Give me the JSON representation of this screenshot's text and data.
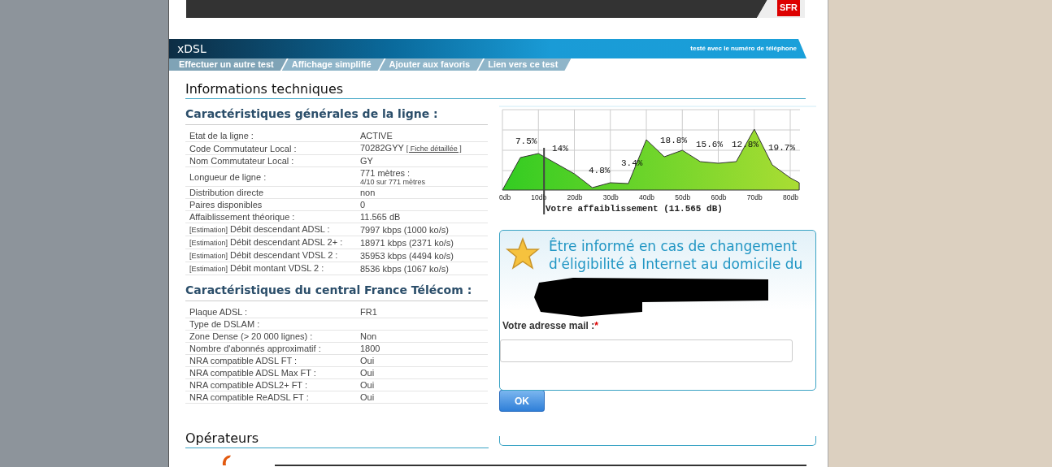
{
  "banner": {
    "logo": "SFR"
  },
  "section_bar": {
    "title": "xDSL",
    "note": "testé avec le numéro de téléphone"
  },
  "tabs": [
    {
      "label": "Effectuer un autre test"
    },
    {
      "label": "Affichage simplifié"
    },
    {
      "label": "Ajouter aux favoris"
    },
    {
      "label": "Lien vers ce test"
    }
  ],
  "page_heading": "Informations techniques",
  "line_section": {
    "title": "Caractéristiques générales de la ligne :",
    "rows": [
      {
        "label": "Etat de la ligne :",
        "value": "ACTIVE"
      },
      {
        "label": "Code Commutateur Local :",
        "value": "70282GYY",
        "link": "[ Fiche détaillée ]"
      },
      {
        "label": "Nom Commutateur Local :",
        "value": "GY"
      },
      {
        "label": "Longueur de ligne :",
        "value": "771 mètres :",
        "subvalue": "4/10 sur 771 mètres"
      },
      {
        "label": "Distribution directe",
        "value": "non"
      },
      {
        "label": "Paires disponibles",
        "value": "0"
      },
      {
        "label": "Affaiblissement théorique :",
        "value": "11.565 dB"
      },
      {
        "prefix": "[Estimation]",
        "label": "Débit descendant ADSL :",
        "value": "7997 kbps (1000 ko/s)"
      },
      {
        "prefix": "[Estimation]",
        "label": "Débit descendant ADSL 2+ :",
        "value": "18971 kbps (2371 ko/s)"
      },
      {
        "prefix": "[Estimation]",
        "label": "Débit descendant VDSL 2 :",
        "value": "35953 kbps (4494 ko/s)"
      },
      {
        "prefix": "[Estimation]",
        "label": "Débit montant VDSL 2 :",
        "value": "8536 kbps (1067 ko/s)"
      }
    ]
  },
  "central_section": {
    "title": "Caractéristiques du central France Télécom :",
    "rows": [
      {
        "label": "Plaque ADSL :",
        "value": "FR1"
      },
      {
        "label": "Type de DSLAM :"
      },
      {
        "label": "Zone Dense (> 20 000 lignes) :",
        "value": "Non"
      },
      {
        "label": "Nombre d'abonnés approximatif :",
        "value": "1800"
      },
      {
        "label": "NRA compatible ADSL FT :",
        "value": "Oui"
      },
      {
        "label": "NRA compatible ADSL Max FT :",
        "value": "Oui"
      },
      {
        "label": "NRA compatible ADSL2+ FT :",
        "value": "Oui"
      },
      {
        "label": "NRA compatible ReADSL FT :",
        "value": "Oui"
      }
    ]
  },
  "operators_heading": "Opérateurs",
  "attenuation_graph": {
    "x_tick_labels": [
      "0db",
      "10db",
      "20db",
      "30db",
      "40db",
      "50db",
      "60db",
      "70db",
      "80db"
    ],
    "percent_labels": [
      "7.5%",
      "14%",
      "4.8%",
      "3.4%",
      "18.8%",
      "15.6%",
      "12.8%",
      "19.7%"
    ],
    "marker_label": "Votre affaiblissement (11.565 dB)"
  },
  "alert_box": {
    "title": "Être informé en cas de changement d'éligibilité à Internet au domicile du",
    "email_label": "Votre adresse mail :",
    "required_mark": "*",
    "button": "OK"
  }
}
